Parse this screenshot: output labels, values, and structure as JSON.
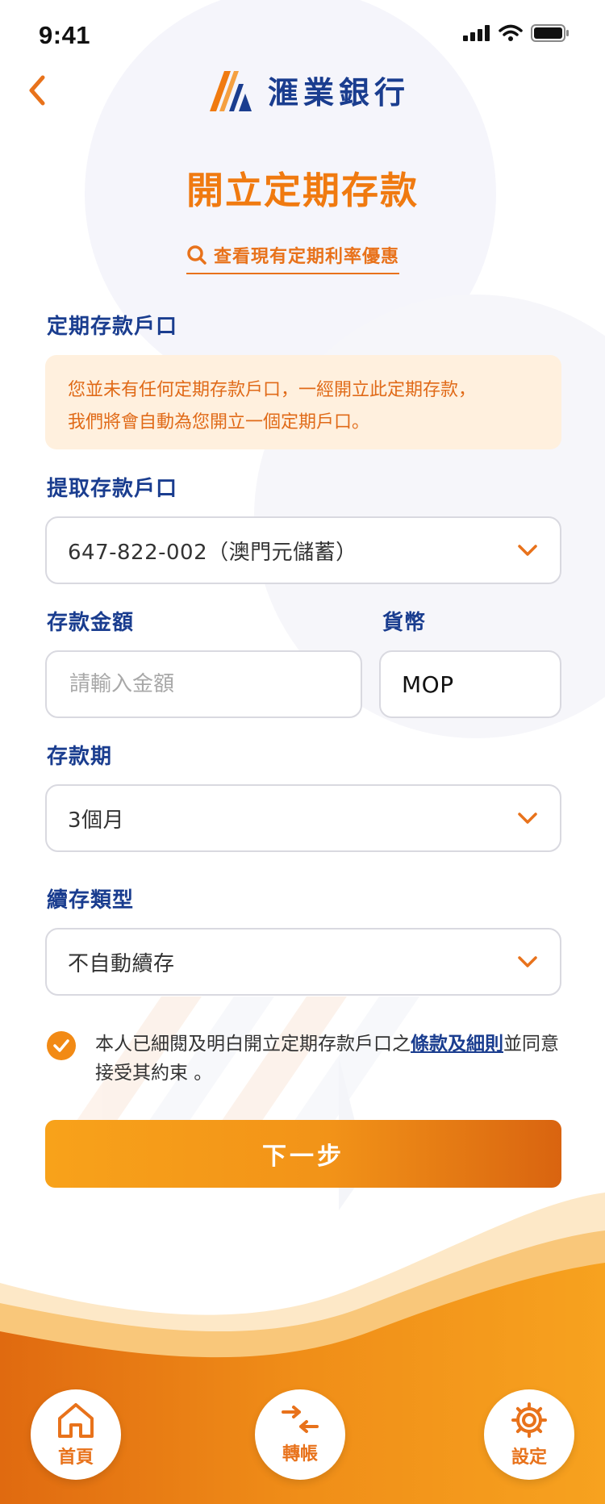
{
  "status_bar": {
    "time": "9:41"
  },
  "header": {
    "brand_name": "滙業銀行",
    "back_icon": "chevron-left-icon"
  },
  "page": {
    "title": "開立定期存款",
    "rate_link": "查看現有定期利率優惠"
  },
  "time_deposit_account": {
    "label": "定期存款戶口",
    "notice_line1": "您並未有任何定期存款戶口，一經開立此定期存款，",
    "notice_line2": "我們將會自動為您開立一個定期戶口。"
  },
  "withdraw_account": {
    "label": "提取存款戶口",
    "value": "647-822-002（澳門元儲蓄）"
  },
  "amount": {
    "label": "存款金額",
    "placeholder": "請輸入金額"
  },
  "currency": {
    "label": "貨幣",
    "value": "MOP"
  },
  "term": {
    "label": "存款期",
    "value": "3個月"
  },
  "renewal": {
    "label": "續存類型",
    "value": "不自動續存"
  },
  "agreement": {
    "checked": true,
    "text_before": "本人已細閱及明白開立定期存款戶口之",
    "link": "條款及細則",
    "text_after": "並同意接受其約束 。"
  },
  "next_button": "下一步",
  "bottom_nav": {
    "items": [
      {
        "label": "首頁",
        "icon": "home-icon"
      },
      {
        "label": "轉帳",
        "icon": "transfer-arrows-icon"
      },
      {
        "label": "設定",
        "icon": "gear-icon"
      }
    ]
  },
  "colors": {
    "accent": "#f07a10",
    "brand_blue": "#1a3d8f",
    "notice_bg": "#fff0de"
  }
}
